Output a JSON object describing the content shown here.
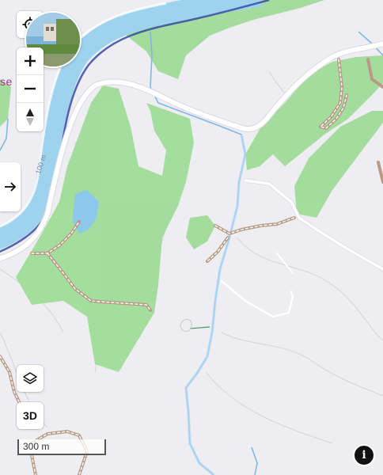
{
  "map": {
    "place_label": "se",
    "contour_label": "100 m",
    "scale_label": "300 m",
    "colors": {
      "background": "#eeeef2",
      "forest": "#9fdc98",
      "water": "#9ed3ee",
      "river_outline": "#3a4aa3",
      "road": "#ffffff",
      "track": "#b89a86",
      "stream": "#7fb8e8"
    }
  },
  "controls": {
    "locate_icon": "crosshair-icon",
    "zoom_in_icon": "plus-icon",
    "zoom_out_icon": "minus-icon",
    "compass_icon": "compass-icon",
    "side_panel_icon": "arrow-right-icon",
    "layers_icon": "layers-icon",
    "three_d_label": "3D",
    "info_label": "i"
  }
}
